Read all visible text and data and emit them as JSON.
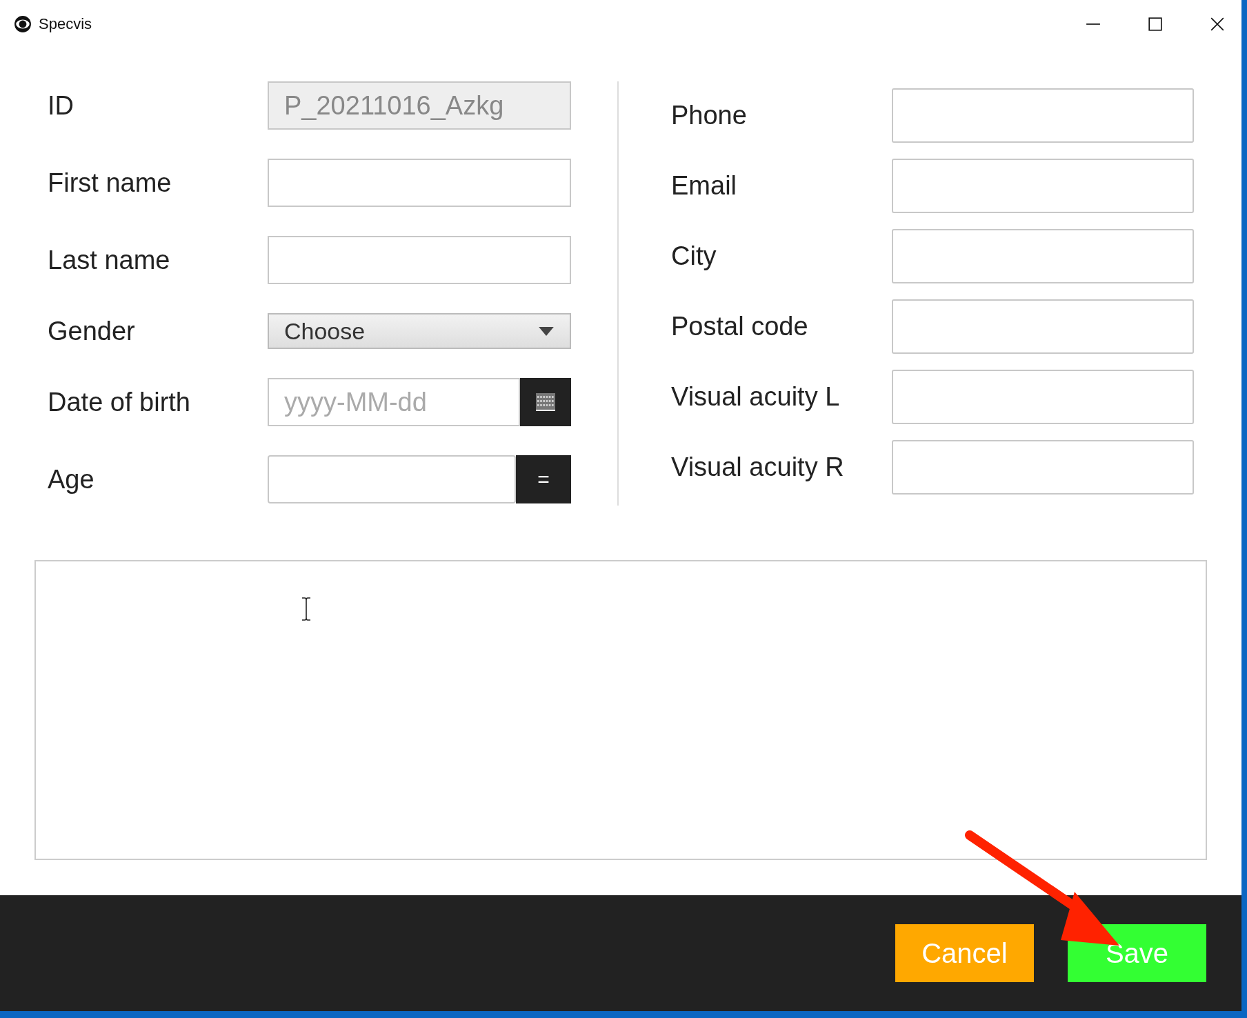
{
  "window": {
    "title": "Specvis"
  },
  "left_fields": [
    {
      "label": "ID",
      "kind": "text",
      "value": "P_20211016_Azkg",
      "disabled": true
    },
    {
      "label": "First name",
      "kind": "text",
      "disabled": false
    },
    {
      "label": "Last name",
      "kind": "text",
      "disabled": false
    },
    {
      "label": "Gender",
      "kind": "dropdown",
      "value": "Choose"
    },
    {
      "label": "Date of birth",
      "kind": "date",
      "placeholder": "yyyy-MM-dd"
    },
    {
      "label": "Age",
      "kind": "compute",
      "button_label": "="
    }
  ],
  "right_fields": [
    {
      "label": "Phone"
    },
    {
      "label": "Email"
    },
    {
      "label": "City"
    },
    {
      "label": "Postal code"
    },
    {
      "label": "Visual acuity L"
    },
    {
      "label": "Visual acuity R"
    }
  ],
  "buttons": [
    {
      "label": "Cancel",
      "color": "#ffa800"
    },
    {
      "label": "Save",
      "color": "#33ff33"
    }
  ]
}
